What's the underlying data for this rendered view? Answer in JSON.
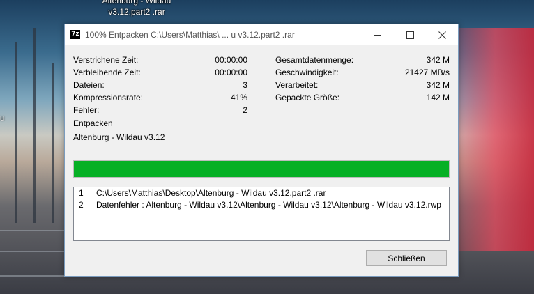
{
  "desktop": {
    "icon_label_line1": "Altenburg - Wildau",
    "icon_label_line2": "v3.12.part2 .rar",
    "edge_glyph": "u"
  },
  "window": {
    "app_icon_text": "7z",
    "title": "100% Entpacken C:\\Users\\Matthias\\ ... u v3.12.part2 .rar",
    "controls": [
      "minimize-icon",
      "maximize-icon",
      "close-icon"
    ]
  },
  "stats_left": [
    {
      "label": "Verstrichene Zeit:",
      "value": "00:00:00"
    },
    {
      "label": "Verbleibende Zeit:",
      "value": "00:00:00"
    },
    {
      "label": "Dateien:",
      "value": "3"
    },
    {
      "label": "Kompressionsrate:",
      "value": "41%"
    },
    {
      "label": "Fehler:",
      "value": "2"
    }
  ],
  "stats_right": [
    {
      "label": "Gesamtdatenmenge:",
      "value": "342 M"
    },
    {
      "label": "Geschwindigkeit:",
      "value": "21427 MB/s"
    },
    {
      "label": "Verarbeitet:",
      "value": "342 M"
    },
    {
      "label": "Gepackte Größe:",
      "value": "142 M"
    }
  ],
  "operation": "Entpacken",
  "current_item": "Altenburg - Wildau v3.12",
  "progress": {
    "percent": 100,
    "color": "#06b025"
  },
  "log": [
    {
      "num": "1",
      "text": "C:\\Users\\Matthias\\Desktop\\Altenburg - Wildau v3.12.part2 .rar"
    },
    {
      "num": "2",
      "text": "Datenfehler : Altenburg - Wildau v3.12\\Altenburg - Wildau v3.12\\Altenburg - Wildau v3.12.rwp"
    }
  ],
  "buttons": {
    "close_label": "Schließen"
  }
}
